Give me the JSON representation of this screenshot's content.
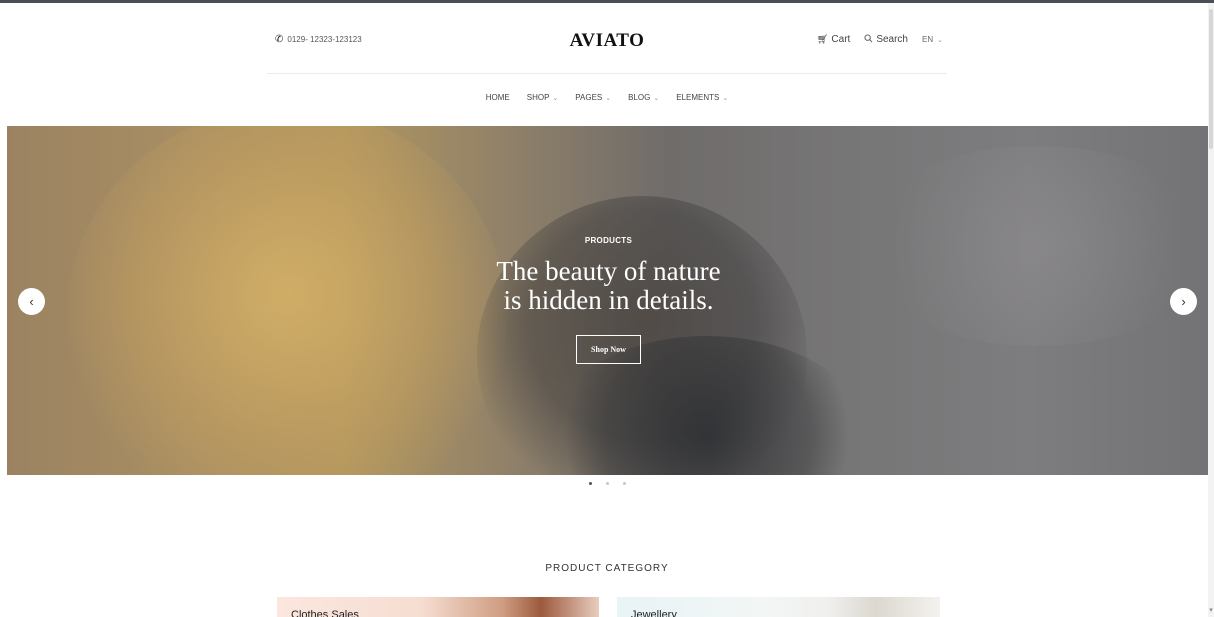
{
  "header": {
    "phone": "0129- 12323-123123",
    "logo": "AVIATO",
    "cart_label": "Cart",
    "search_label": "Search",
    "language": "EN"
  },
  "nav": {
    "items": [
      {
        "label": "HOME",
        "has_dropdown": false
      },
      {
        "label": "SHOP",
        "has_dropdown": true
      },
      {
        "label": "PAGES",
        "has_dropdown": true
      },
      {
        "label": "BLOG",
        "has_dropdown": true
      },
      {
        "label": "ELEMENTS",
        "has_dropdown": true
      }
    ]
  },
  "hero": {
    "eyebrow": "PRODUCTS",
    "title_line1": "The beauty of nature",
    "title_line2": "is hidden in details.",
    "button_label": "Shop Now",
    "slides_count": 3,
    "active_slide": 1
  },
  "icons": {
    "phone": "phone-icon",
    "cart": "cart-icon",
    "search": "search-icon",
    "prev": "chevron-left-icon",
    "next": "chevron-right-icon"
  },
  "product_category": {
    "title": "PRODUCT CATEGORY",
    "cards": [
      {
        "label": "Clothes Sales"
      },
      {
        "label": "Jewellery"
      }
    ]
  },
  "colors": {
    "text_dark": "#111111",
    "hero_text": "#ffffff",
    "top_rule": "#4a4f55"
  }
}
